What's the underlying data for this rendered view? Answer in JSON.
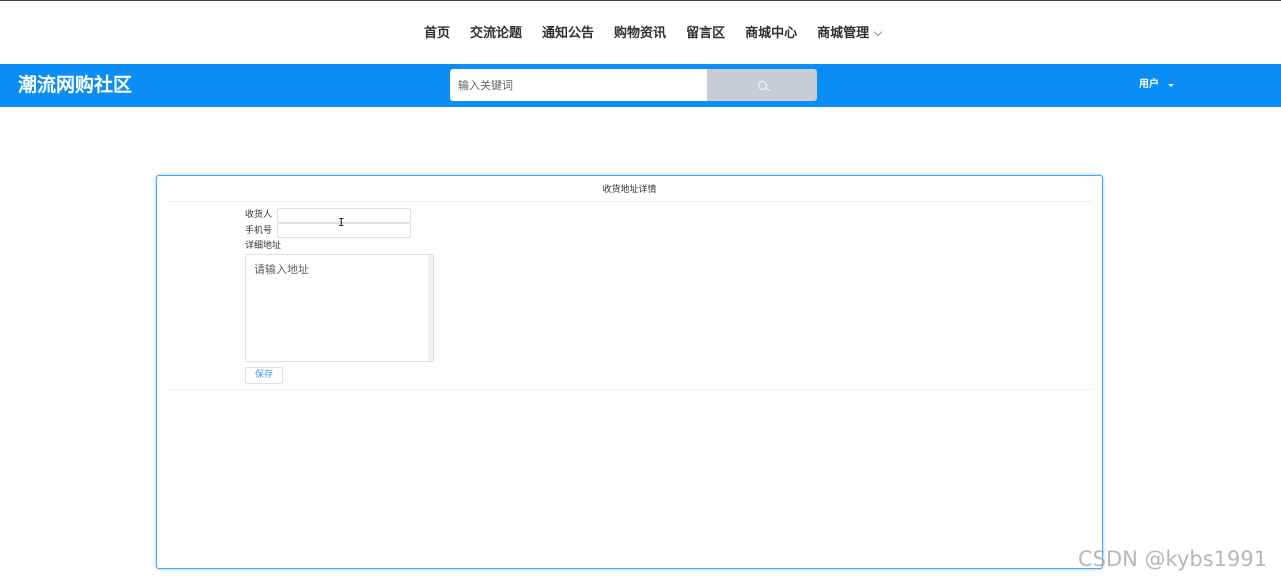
{
  "nav": {
    "items": [
      {
        "label": "首页"
      },
      {
        "label": "交流论题"
      },
      {
        "label": "通知公告"
      },
      {
        "label": "购物资讯"
      },
      {
        "label": "留言区"
      },
      {
        "label": "商城中心"
      },
      {
        "label": "商城管理",
        "has_submenu": true
      }
    ]
  },
  "header": {
    "brand": "潮流网购社区",
    "search_placeholder": "输入关键词",
    "search_icon": "search-icon",
    "user_label": "用户",
    "user_dropdown_icon": "caret-down-icon",
    "background_color": "#0a8df5"
  },
  "card": {
    "title": "收货地址详情",
    "fields": {
      "consignee_label": "收货人",
      "consignee_value": "",
      "phone_label": "手机号",
      "phone_value": "",
      "address_label": "详细地址",
      "address_placeholder": "请输入地址"
    },
    "save_label": "保存",
    "border_color": "#4aa9f5"
  },
  "cursor_icon": "text-cursor-icon",
  "watermark": "CSDN @kybs1991"
}
